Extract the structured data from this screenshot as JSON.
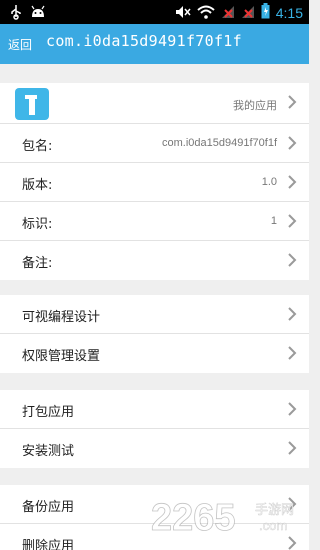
{
  "statusbar": {
    "time": "4:15",
    "icons": [
      "usb-icon",
      "android-icon",
      "mute-icon",
      "wifi-icon",
      "signal-1-icon",
      "signal-2-icon",
      "battery-icon"
    ]
  },
  "titlebar": {
    "back_label": "返回",
    "title": "com.i0da15d9491f70f1f"
  },
  "group1": {
    "app_row": {
      "value": "我的应用",
      "icon": "app-info-icon"
    },
    "rows": [
      {
        "label": "包名:",
        "value": "com.i0da15d9491f70f1f"
      },
      {
        "label": "版本:",
        "value": "1.0"
      },
      {
        "label": "标识:",
        "value": "1"
      },
      {
        "label": "备注:",
        "value": ""
      }
    ]
  },
  "group2": {
    "rows": [
      {
        "label": "可视编程设计"
      },
      {
        "label": "权限管理设置"
      }
    ]
  },
  "group3": {
    "rows": [
      {
        "label": "打包应用"
      },
      {
        "label": "安装测试"
      }
    ]
  },
  "group4": {
    "rows": [
      {
        "label": "备份应用"
      },
      {
        "label": "删除应用"
      }
    ]
  },
  "watermark": {
    "number": "2265",
    "suffix": "手游网",
    "domain": ".com"
  },
  "colors": {
    "accent": "#3aa9e2",
    "background": "#efefef",
    "chevron": "#9a9a9a",
    "clock": "#39b3e6"
  }
}
